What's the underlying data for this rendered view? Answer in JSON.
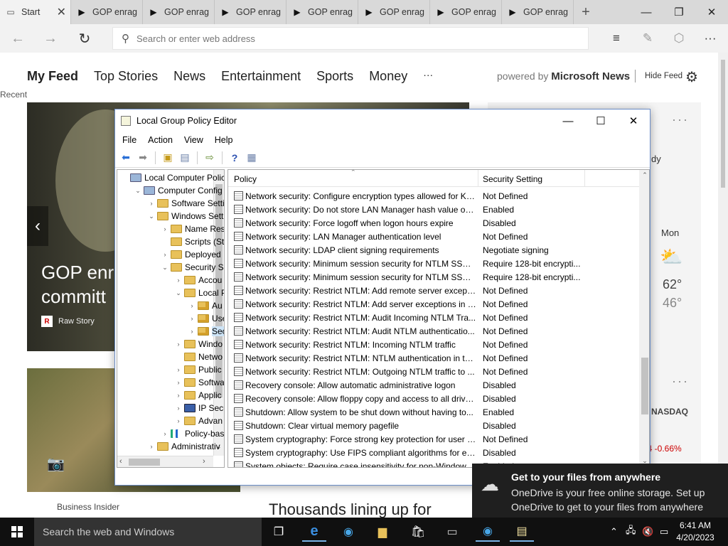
{
  "browser": {
    "tabs": [
      {
        "label": "Start",
        "icon": "page-icon"
      },
      {
        "label": "GOP enrag",
        "icon": "media-icon"
      },
      {
        "label": "GOP enrag",
        "icon": "media-icon"
      },
      {
        "label": "GOP enrag",
        "icon": "media-icon"
      },
      {
        "label": "GOP enrag",
        "icon": "media-icon"
      },
      {
        "label": "GOP enrag",
        "icon": "media-icon"
      },
      {
        "label": "GOP enrag",
        "icon": "media-icon"
      },
      {
        "label": "GOP enrag",
        "icon": "media-icon"
      }
    ],
    "address_placeholder": "Search or enter web address"
  },
  "feed": {
    "nav": [
      "My Feed",
      "Top Stories",
      "News",
      "Entertainment",
      "Sports",
      "Money"
    ],
    "nav_more": "···",
    "powered_prefix": "powered by",
    "powered_brand": "Microsoft News",
    "hide_feed": "Hide Feed",
    "recent": "Recent",
    "hero_title_line1": "GOP enr",
    "hero_title_line2": "committ",
    "hero_source": "Raw Story",
    "card2_source": "Business Insider",
    "card3_title": "Thousands lining up for",
    "right_text": "dy",
    "weather_day": "Mon",
    "weather_high": "62°",
    "weather_low": "46°",
    "stock_name": "NASDAQ",
    "stock_change": "74 -0.66%"
  },
  "gpe": {
    "title": "Local Group Policy Editor",
    "menu": [
      "File",
      "Action",
      "View",
      "Help"
    ],
    "tree": [
      {
        "label": "Local Computer Polic",
        "indent": 0,
        "exp": "",
        "icon": "pc"
      },
      {
        "label": "Computer Config",
        "indent": 1,
        "exp": "⌄",
        "icon": "pc"
      },
      {
        "label": "Software Setti",
        "indent": 2,
        "exp": "›",
        "icon": "folder"
      },
      {
        "label": "Windows Sett",
        "indent": 2,
        "exp": "⌄",
        "icon": "folder"
      },
      {
        "label": "Name Res",
        "indent": 3,
        "exp": "›",
        "icon": "folder"
      },
      {
        "label": "Scripts (Sta",
        "indent": 3,
        "exp": "",
        "icon": "folder"
      },
      {
        "label": "Deployed",
        "indent": 3,
        "exp": "›",
        "icon": "folder"
      },
      {
        "label": "Security Se",
        "indent": 3,
        "exp": "⌄",
        "icon": "folder"
      },
      {
        "label": "Accou",
        "indent": 4,
        "exp": "›",
        "icon": "folder"
      },
      {
        "label": "Local P",
        "indent": 4,
        "exp": "⌄",
        "icon": "folder"
      },
      {
        "label": "Au",
        "indent": 5,
        "exp": "›",
        "icon": "lock"
      },
      {
        "label": "Use",
        "indent": 5,
        "exp": "›",
        "icon": "lock"
      },
      {
        "label": "Sec",
        "indent": 5,
        "exp": "›",
        "icon": "lock",
        "selected": true
      },
      {
        "label": "Windo",
        "indent": 4,
        "exp": "›",
        "icon": "folder"
      },
      {
        "label": "Netwo",
        "indent": 4,
        "exp": "",
        "icon": "folder"
      },
      {
        "label": "Public",
        "indent": 4,
        "exp": "›",
        "icon": "folder"
      },
      {
        "label": "Softwa",
        "indent": 4,
        "exp": "›",
        "icon": "folder"
      },
      {
        "label": "Applic",
        "indent": 4,
        "exp": "›",
        "icon": "folder"
      },
      {
        "label": "IP Secu",
        "indent": 4,
        "exp": "›",
        "icon": "blue"
      },
      {
        "label": "Advan",
        "indent": 4,
        "exp": "›",
        "icon": "folder"
      },
      {
        "label": "Policy-bas",
        "indent": 3,
        "exp": "›",
        "icon": "chart"
      },
      {
        "label": "Administrativ",
        "indent": 2,
        "exp": "›",
        "icon": "folder"
      }
    ],
    "columns": {
      "policy": "Policy",
      "setting": "Security Setting"
    },
    "rows": [
      {
        "policy": "Network security: Configure encryption types allowed for Ke...",
        "setting": "Not Defined"
      },
      {
        "policy": "Network security: Do not store LAN Manager hash value on ...",
        "setting": "Enabled"
      },
      {
        "policy": "Network security: Force logoff when logon hours expire",
        "setting": "Disabled"
      },
      {
        "policy": "Network security: LAN Manager authentication level",
        "setting": "Not Defined"
      },
      {
        "policy": "Network security: LDAP client signing requirements",
        "setting": "Negotiate signing"
      },
      {
        "policy": "Network security: Minimum session security for NTLM SSP ...",
        "setting": "Require 128-bit encrypti..."
      },
      {
        "policy": "Network security: Minimum session security for NTLM SSP ...",
        "setting": "Require 128-bit encrypti..."
      },
      {
        "policy": "Network security: Restrict NTLM: Add remote server excepti...",
        "setting": "Not Defined"
      },
      {
        "policy": "Network security: Restrict NTLM: Add server exceptions in t...",
        "setting": "Not Defined"
      },
      {
        "policy": "Network security: Restrict NTLM: Audit Incoming NTLM Tra...",
        "setting": "Not Defined"
      },
      {
        "policy": "Network security: Restrict NTLM: Audit NTLM authenticatio...",
        "setting": "Not Defined"
      },
      {
        "policy": "Network security: Restrict NTLM: Incoming NTLM traffic",
        "setting": "Not Defined"
      },
      {
        "policy": "Network security: Restrict NTLM: NTLM authentication in th...",
        "setting": "Not Defined"
      },
      {
        "policy": "Network security: Restrict NTLM: Outgoing NTLM traffic to ...",
        "setting": "Not Defined"
      },
      {
        "policy": "Recovery console: Allow automatic administrative logon",
        "setting": "Disabled"
      },
      {
        "policy": "Recovery console: Allow floppy copy and access to all drives...",
        "setting": "Disabled"
      },
      {
        "policy": "Shutdown: Allow system to be shut down without having to...",
        "setting": "Enabled"
      },
      {
        "policy": "Shutdown: Clear virtual memory pagefile",
        "setting": "Disabled"
      },
      {
        "policy": "System cryptography: Force strong key protection for user k...",
        "setting": "Not Defined"
      },
      {
        "policy": "System cryptography: Use FIPS compliant algorithms for en...",
        "setting": "Disabled"
      },
      {
        "policy": "System objects: Require case insensitivity for non-Windows ...",
        "setting": "Enabled"
      }
    ]
  },
  "toast": {
    "title": "Get to your files from anywhere",
    "body": "OneDrive is your free online storage. Set up OneDrive to get to your files from anywhere with your phone and PC."
  },
  "taskbar": {
    "search_placeholder": "Search the web and Windows",
    "time": "6:41 AM",
    "date": "4/20/2023"
  },
  "colors": {
    "accent": "#0078d7",
    "stock_down": "#cc0000"
  }
}
